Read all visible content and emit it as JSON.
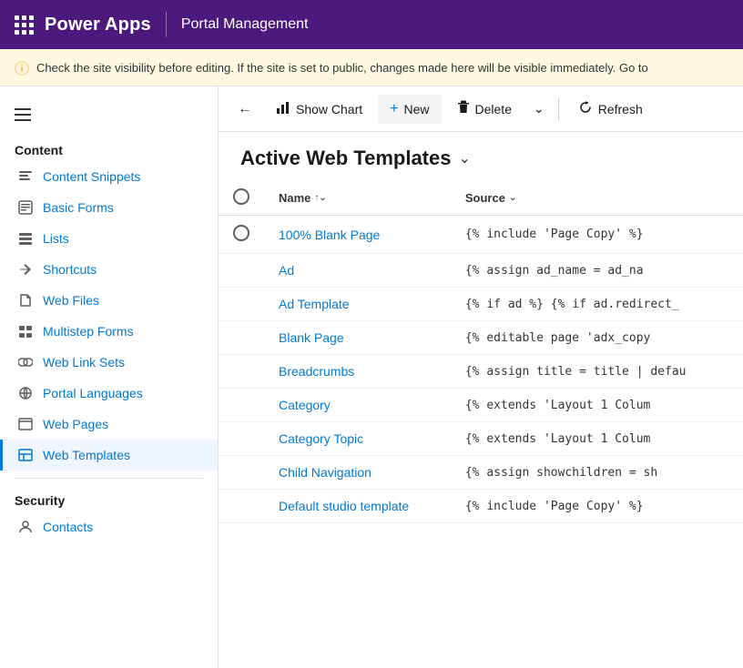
{
  "topBar": {
    "appName": "Power Apps",
    "pageName": "Portal Management"
  },
  "infoBar": {
    "message": "Check the site visibility before editing. If the site is set to public, changes made here will be visible immediately. Go to"
  },
  "toolbar": {
    "backLabel": "←",
    "showChartLabel": "Show Chart",
    "newLabel": "New",
    "deleteLabel": "Delete",
    "refreshLabel": "Refresh"
  },
  "pageTitle": "Active Web Templates",
  "tableHeaders": {
    "name": "Name",
    "source": "Source"
  },
  "tableRows": [
    {
      "name": "100% Blank Page",
      "source": "{% include 'Page Copy' %}"
    },
    {
      "name": "Ad",
      "source": "{% assign ad_name = ad_na"
    },
    {
      "name": "Ad Template",
      "source": "{% if ad %} {% if ad.redirect_"
    },
    {
      "name": "Blank Page",
      "source": "{% editable page 'adx_copy"
    },
    {
      "name": "Breadcrumbs",
      "source": "{% assign title = title | defau"
    },
    {
      "name": "Category",
      "source": "{% extends 'Layout 1 Colum"
    },
    {
      "name": "Category Topic",
      "source": "{% extends 'Layout 1 Colum"
    },
    {
      "name": "Child Navigation",
      "source": "{% assign showchildren = sh"
    },
    {
      "name": "Default studio template",
      "source": "{% include 'Page Copy' %}"
    }
  ],
  "sidebar": {
    "contentSection": "Content",
    "securitySection": "Security",
    "items": [
      {
        "label": "Content Snippets",
        "icon": "snippet"
      },
      {
        "label": "Basic Forms",
        "icon": "form"
      },
      {
        "label": "Lists",
        "icon": "list"
      },
      {
        "label": "Shortcuts",
        "icon": "shortcut"
      },
      {
        "label": "Web Files",
        "icon": "file"
      },
      {
        "label": "Multistep Forms",
        "icon": "multistep"
      },
      {
        "label": "Web Link Sets",
        "icon": "link"
      },
      {
        "label": "Portal Languages",
        "icon": "language"
      },
      {
        "label": "Web Pages",
        "icon": "webpage"
      },
      {
        "label": "Web Templates",
        "icon": "template",
        "active": true
      }
    ],
    "securityItems": [
      {
        "label": "Contacts",
        "icon": "contact"
      }
    ]
  }
}
